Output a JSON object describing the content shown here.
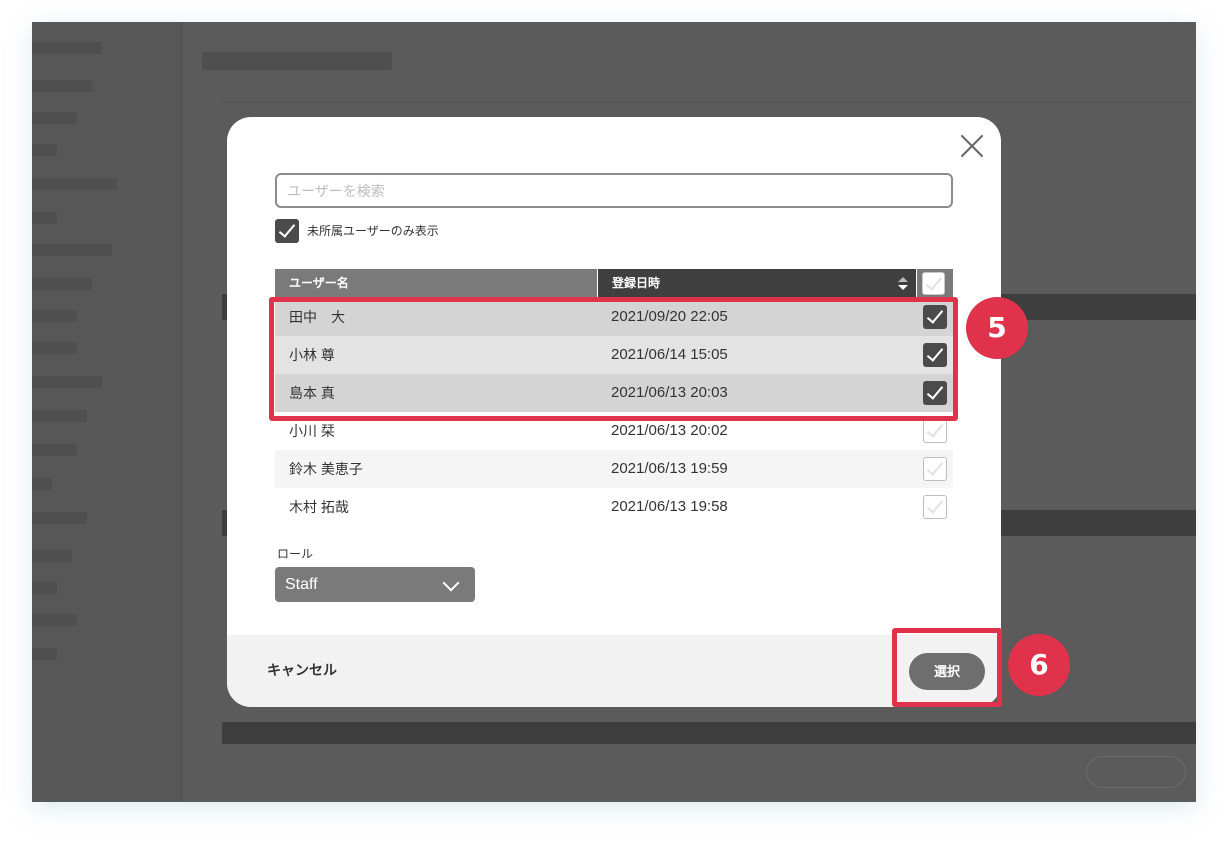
{
  "modal": {
    "search_placeholder": "ユーザーを検索",
    "filter_label": "未所属ユーザーのみ表示",
    "filter_checked": true,
    "table": {
      "col_name": "ユーザー名",
      "col_date": "登録日時",
      "rows": [
        {
          "name": "田中　大",
          "date": "2021/09/20 22:05",
          "checked": true
        },
        {
          "name": "小林 尊",
          "date": "2021/06/14 15:05",
          "checked": true
        },
        {
          "name": "島本 真",
          "date": "2021/06/13 20:03",
          "checked": true
        },
        {
          "name": "小川 栞",
          "date": "2021/06/13 20:02",
          "checked": false
        },
        {
          "name": "鈴木 美恵子",
          "date": "2021/06/13 19:59",
          "checked": false
        },
        {
          "name": "木村 拓哉",
          "date": "2021/06/13 19:58",
          "checked": false
        }
      ]
    },
    "role_label": "ロール",
    "role_value": "Staff",
    "cancel_label": "キャンセル",
    "select_label": "選択"
  },
  "annotations": {
    "step5": "5",
    "step6": "6",
    "color": "#e0324b"
  }
}
